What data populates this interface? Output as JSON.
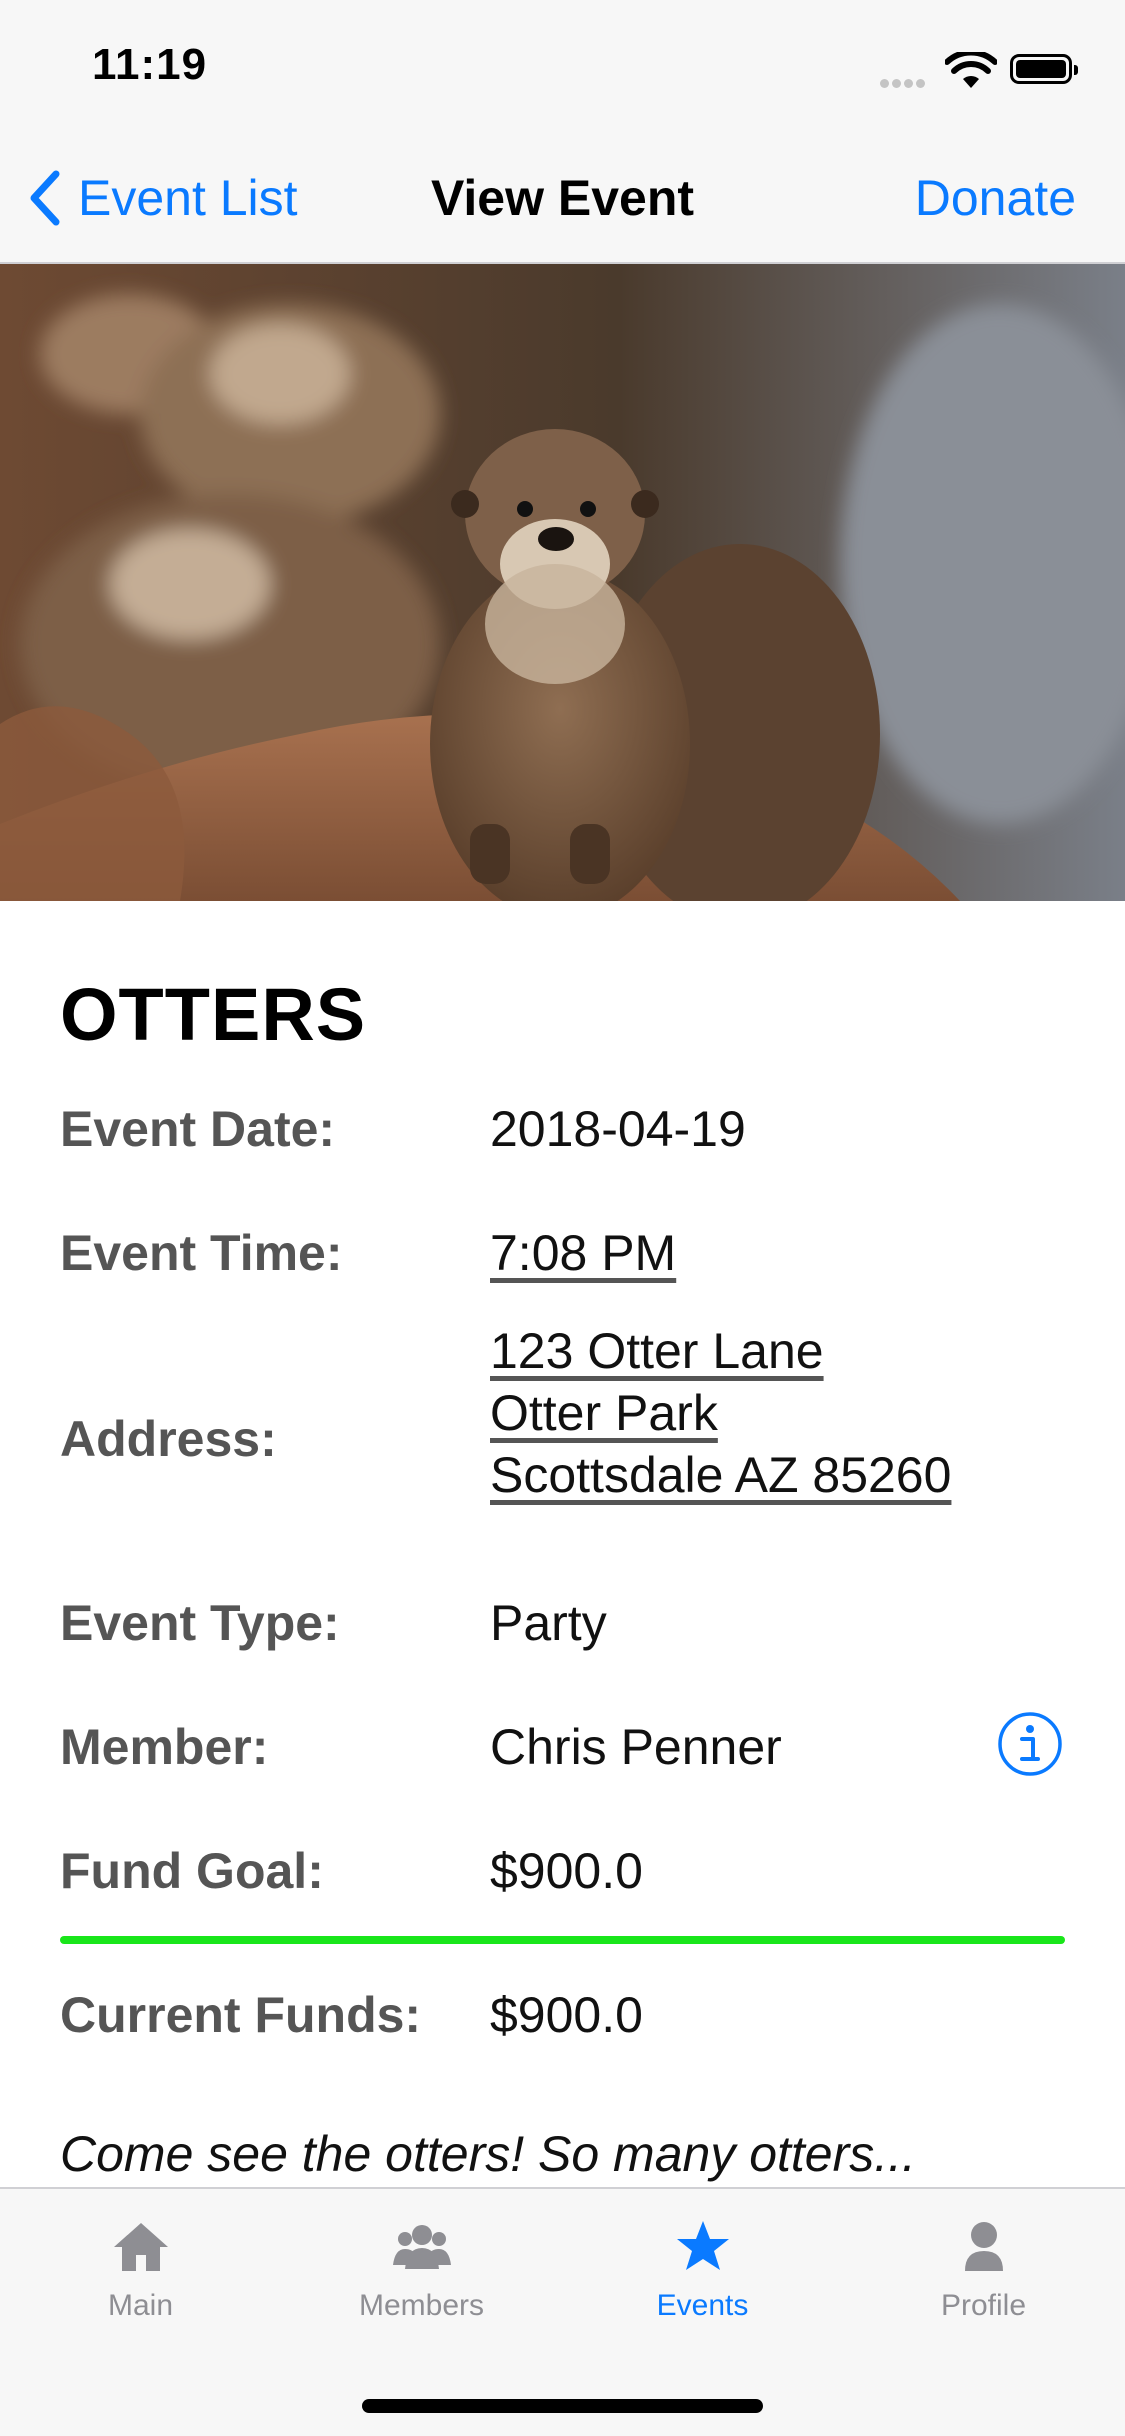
{
  "status_bar": {
    "time": "11:19"
  },
  "nav": {
    "back_label": "Event List",
    "title": "View Event",
    "right_action": "Donate"
  },
  "event": {
    "name": "OTTERS",
    "rows": {
      "date": {
        "label": "Event Date:",
        "value": "2018-04-19"
      },
      "time": {
        "label": "Event Time:",
        "value": "7:08 PM"
      },
      "address": {
        "label": "Address:",
        "lines": [
          "123 Otter Lane",
          "Otter Park",
          "Scottsdale AZ 85260"
        ]
      },
      "type": {
        "label": "Event Type:",
        "value": "Party"
      },
      "member": {
        "label": "Member:",
        "value": "Chris Penner"
      },
      "fund_goal": {
        "label": "Fund Goal:",
        "value": "$900.0"
      },
      "current_funds": {
        "label": "Current Funds:",
        "value": "$900.0"
      }
    },
    "funding_progress": 1.0,
    "description": "Come see the otters! So many otters..."
  },
  "tabs": [
    {
      "label": "Main",
      "icon": "house-icon",
      "active": false
    },
    {
      "label": "Members",
      "icon": "people-icon",
      "active": false
    },
    {
      "label": "Events",
      "icon": "star-icon",
      "active": true
    },
    {
      "label": "Profile",
      "icon": "person-icon",
      "active": false
    }
  ],
  "colors": {
    "accent": "#0a7aff",
    "progress": "#19e61a",
    "label_gray": "#555555",
    "tab_inactive": "#8e8e93"
  }
}
